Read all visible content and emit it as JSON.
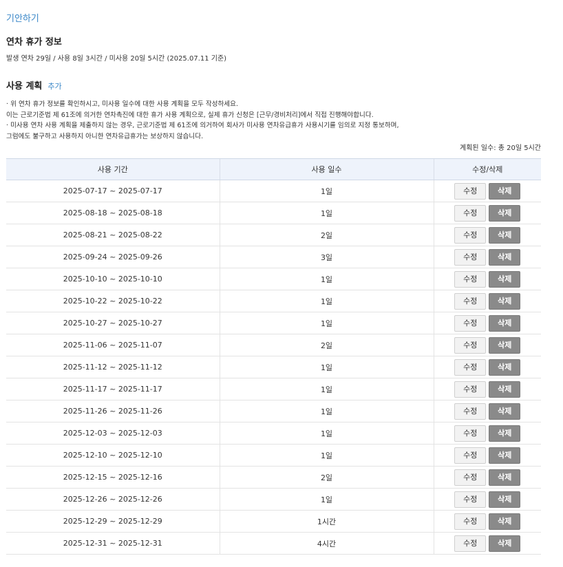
{
  "draft_link": "기안하기",
  "leave_info": {
    "title": "연차 휴가 정보",
    "summary": "발생 연차 29일 / 사용 8일 3시간 / 미사용 20일 5시간 (2025.07.11 기준)"
  },
  "usage_plan": {
    "title": "사용 계획",
    "add_label": "추가",
    "notes": [
      "· 위 연차 휴가 정보를 확인하시고, 미사용 일수에 대한 사용 계획을 모두 작성하세요.",
      "이는 근로기준법 제 61조에 의거한 연차촉진에 대한 휴가 사용 계획으로, 실제 휴가 신청은 [근무/경비처리]에서 직접 진행해야합니다.",
      "· 미사용 연차 사용 계획을 제출하지 않는 경우, 근로기준법 제 61조에 의거하여 회사가 미사용 연차유급휴가 사용시기를 임의로 지정 통보하며,",
      "그럼에도 불구하고 사용하지 아니한 연차유급휴가는 보상하지 않습니다."
    ],
    "planned_total": "계획된 일수: 총 20일 5시간",
    "columns": [
      "사용 기간",
      "사용 일수",
      "수정/삭제"
    ],
    "edit_label": "수정",
    "delete_label": "삭제",
    "rows": [
      {
        "period": "2025-07-17 ~ 2025-07-17",
        "days": "1일"
      },
      {
        "period": "2025-08-18 ~ 2025-08-18",
        "days": "1일"
      },
      {
        "period": "2025-08-21 ~ 2025-08-22",
        "days": "2일"
      },
      {
        "period": "2025-09-24 ~ 2025-09-26",
        "days": "3일"
      },
      {
        "period": "2025-10-10 ~ 2025-10-10",
        "days": "1일"
      },
      {
        "period": "2025-10-22 ~ 2025-10-22",
        "days": "1일"
      },
      {
        "period": "2025-10-27 ~ 2025-10-27",
        "days": "1일"
      },
      {
        "period": "2025-11-06 ~ 2025-11-07",
        "days": "2일"
      },
      {
        "period": "2025-11-12 ~ 2025-11-12",
        "days": "1일"
      },
      {
        "period": "2025-11-17 ~ 2025-11-17",
        "days": "1일"
      },
      {
        "period": "2025-11-26 ~ 2025-11-26",
        "days": "1일"
      },
      {
        "period": "2025-12-03 ~ 2025-12-03",
        "days": "1일"
      },
      {
        "period": "2025-12-10 ~ 2025-12-10",
        "days": "1일"
      },
      {
        "period": "2025-12-15 ~ 2025-12-16",
        "days": "2일"
      },
      {
        "period": "2025-12-26 ~ 2025-12-26",
        "days": "1일"
      },
      {
        "period": "2025-12-29 ~ 2025-12-29",
        "days": "1시간"
      },
      {
        "period": "2025-12-31 ~ 2025-12-31",
        "days": "4시간"
      }
    ]
  }
}
